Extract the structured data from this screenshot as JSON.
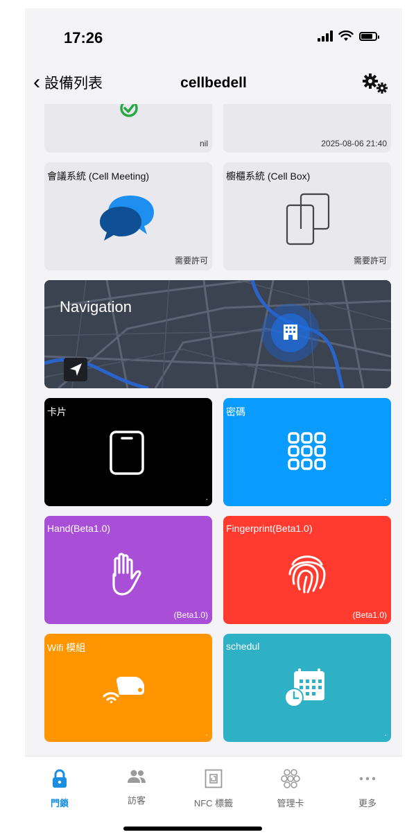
{
  "status_bar": {
    "time": "17:26"
  },
  "nav": {
    "back_label": "設備列表",
    "title": "cellbedell"
  },
  "top_cards": {
    "left_footer": "nil",
    "right_footer": "2025-08-06 21:40"
  },
  "cards": {
    "meeting": {
      "title": "會議系統 (Cell Meeting)",
      "footer": "需要許可"
    },
    "box": {
      "title": "櫥櫃系統 (Cell Box)",
      "footer": "需要許可"
    },
    "navigation": {
      "title": "Navigation"
    },
    "card": {
      "title": "卡片",
      "footer": "."
    },
    "password": {
      "title": "密碼",
      "footer": "."
    },
    "hand": {
      "title": "Hand(Beta1.0)",
      "footer": "(Beta1.0)"
    },
    "fingerprint": {
      "title": "Fingerprint(Beta1.0)",
      "footer": "(Beta1.0)"
    },
    "wifi": {
      "title": "Wifi 模組",
      "footer": "."
    },
    "schedule": {
      "title": "schedul",
      "footer": "."
    }
  },
  "colors": {
    "card_black": "#000000",
    "password_blue": "#0a9bff",
    "hand_purple": "#a94ed6",
    "fingerprint_red": "#ff3b30",
    "wifi_orange": "#ff9500",
    "schedule_teal": "#2eb0c5",
    "tab_active": "#1a8fe0"
  },
  "tabs": [
    {
      "label": "門鎖",
      "icon": "lock-icon",
      "active": true
    },
    {
      "label": "訪客",
      "icon": "people-icon",
      "active": false
    },
    {
      "label": "NFC 標籤",
      "icon": "nfc-tag-icon",
      "active": false
    },
    {
      "label": "管理卡",
      "icon": "grid-circles-icon",
      "active": false
    },
    {
      "label": "更多",
      "icon": "more-dots-icon",
      "active": false
    }
  ]
}
